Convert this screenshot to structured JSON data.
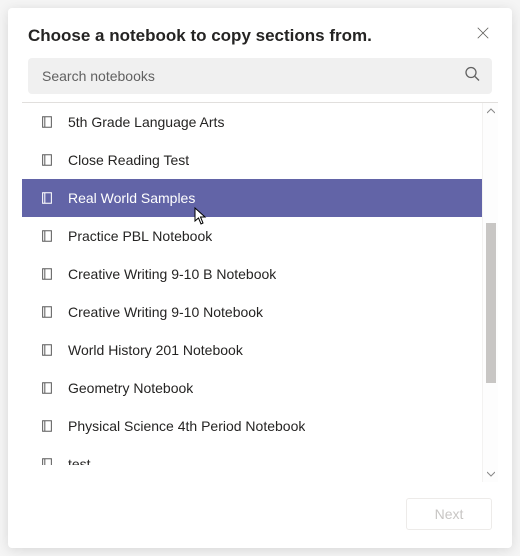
{
  "dialog": {
    "title": "Choose a notebook to copy sections from."
  },
  "search": {
    "placeholder": "Search notebooks"
  },
  "notebooks": [
    {
      "label": "5th Grade Language Arts",
      "selected": false
    },
    {
      "label": "Close Reading Test",
      "selected": false
    },
    {
      "label": "Real World Samples",
      "selected": true
    },
    {
      "label": "Practice PBL Notebook",
      "selected": false
    },
    {
      "label": "Creative Writing 9-10 B Notebook",
      "selected": false
    },
    {
      "label": "Creative Writing 9-10 Notebook",
      "selected": false
    },
    {
      "label": "World History 201 Notebook",
      "selected": false
    },
    {
      "label": "Geometry Notebook",
      "selected": false
    },
    {
      "label": "Physical Science 4th Period Notebook",
      "selected": false
    },
    {
      "label": "test",
      "selected": false
    }
  ],
  "footer": {
    "next_label": "Next"
  },
  "scrollbar": {
    "thumb_top_pct": 30,
    "thumb_height_pct": 46
  }
}
